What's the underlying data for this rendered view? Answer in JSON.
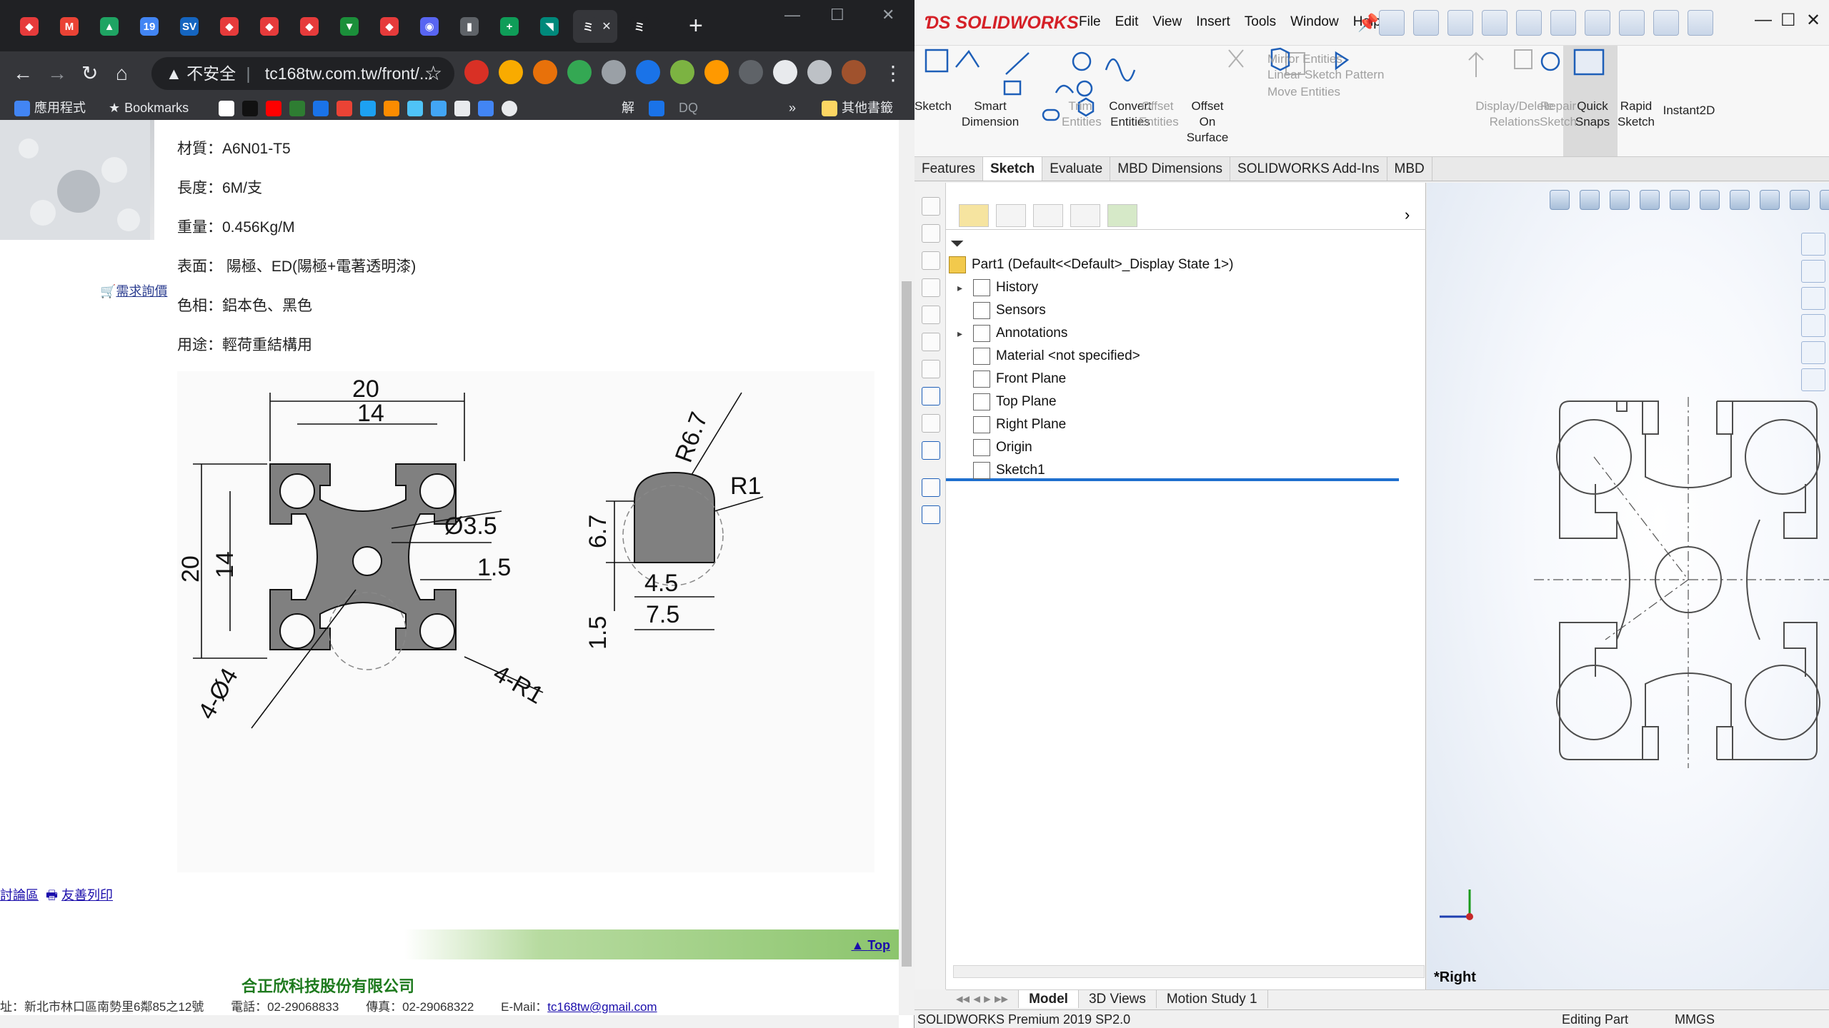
{
  "chrome": {
    "tabs": [
      {
        "icon": "red-app-icon",
        "color": "#e63b3b",
        "glyph": "◆"
      },
      {
        "icon": "gmail-icon",
        "color": "#ea4335",
        "glyph": "M"
      },
      {
        "icon": "drive-icon",
        "color": "#1fa463",
        "glyph": "▲"
      },
      {
        "icon": "calendar-icon",
        "color": "#4285f4",
        "glyph": "19"
      },
      {
        "icon": "sv-icon",
        "color": "#1565c0",
        "glyph": "SV"
      },
      {
        "icon": "red-app-icon",
        "color": "#e63b3b",
        "glyph": "◆"
      },
      {
        "icon": "red-app-icon",
        "color": "#e63b3b",
        "glyph": "◆"
      },
      {
        "icon": "red-app-icon",
        "color": "#e63b3b",
        "glyph": "◆"
      },
      {
        "icon": "green-hat-icon",
        "color": "#1b8f3a",
        "glyph": "▼"
      },
      {
        "icon": "red-app-icon",
        "color": "#e63b3b",
        "glyph": "◆"
      },
      {
        "icon": "discord-icon",
        "color": "#5865f2",
        "glyph": "◉"
      },
      {
        "icon": "book-icon",
        "color": "#5f6368",
        "glyph": "▮"
      },
      {
        "icon": "sheets-icon",
        "color": "#0f9d58",
        "glyph": "+"
      },
      {
        "icon": "teal-app-icon",
        "color": "#00897b",
        "glyph": "◥"
      },
      {
        "icon": "loading-icon",
        "color": "#35363a",
        "glyph": "ミ"
      },
      {
        "icon": "loading-icon",
        "color": "#202124",
        "glyph": "ミ"
      }
    ],
    "tab_close": "✕",
    "new_tab": "+",
    "omnibox": {
      "warning": "▲ 不安全",
      "url": "tc168tw.com.tw/front/..."
    },
    "bookmarks": {
      "apps": "應用程式",
      "bookmarks": "Bookmarks",
      "jie": "解",
      "dq": "DQ",
      "more": "»",
      "other": "其他書籤"
    },
    "colors": {
      "tabbar": "#202124",
      "toolbar": "#35363a",
      "link": "#1a0dab",
      "company": "#1e7a1e"
    }
  },
  "product": {
    "specs": [
      {
        "label": "材質：A6N01-T5"
      },
      {
        "label": "長度：6M/支"
      },
      {
        "label": "重量：0.456Kg/M"
      },
      {
        "label": "表面： 陽極、ED(陽極+電著透明漆)"
      },
      {
        "label": "色相：鋁本色、黑色"
      },
      {
        "label": "用途：輕荷重結構用"
      }
    ],
    "inquiry": "需求詢價",
    "drawing": {
      "dim_20_top": "20",
      "dim_14_top": "14",
      "dim_20_side": "20",
      "dim_14_side": "14",
      "hole": "Ø3.5",
      "dim_1_5": "1.5",
      "holes4": "4-Ø4",
      "radius4": "4-R1",
      "r6_7": "R6.7",
      "r1": "R1",
      "d6_7": "6.7",
      "d1_5": "1.5",
      "d4_5": "4.5",
      "d7_5": "7.5"
    },
    "links": {
      "forum": "討論區",
      "print": "友善列印"
    },
    "top": "Top",
    "company": "合正欣科技股份有限公司",
    "address": "址：新北市林口區南勢里6鄰85之12號",
    "phone": "電話：02-29068833",
    "fax": "傳真：02-29068322",
    "email_label": "E-Mail：",
    "email": "tc168tw@gmail.com"
  },
  "sw": {
    "logo": "SOLIDWORKS",
    "menu": [
      "File",
      "Edit",
      "View",
      "Insert",
      "Tools",
      "Window",
      "Help"
    ],
    "commands": [
      {
        "label": "Sketch",
        "enabled": true
      },
      {
        "label": "Smart\nDimension",
        "enabled": true
      },
      {
        "label": "Trim\nEntities",
        "enabled": false
      },
      {
        "label": "Convert\nEntities",
        "enabled": true
      },
      {
        "label": "Offset\nEntities",
        "enabled": false
      },
      {
        "label": "Offset\nOn\nSurface",
        "enabled": true
      },
      {
        "label": "Mirror Entities",
        "enabled": false
      },
      {
        "label": "Linear Sketch Pattern",
        "enabled": false
      },
      {
        "label": "Move Entities",
        "enabled": false
      },
      {
        "label": "Display/Delete\nRelations",
        "enabled": false
      },
      {
        "label": "Repair\nSketch",
        "enabled": false
      },
      {
        "label": "Quick\nSnaps",
        "enabled": true
      },
      {
        "label": "Rapid\nSketch",
        "enabled": true
      },
      {
        "label": "Instant2D",
        "enabled": true
      }
    ],
    "tabs": [
      "Features",
      "Sketch",
      "Evaluate",
      "MBD Dimensions",
      "SOLIDWORKS Add-Ins",
      "MBD"
    ],
    "active_tab": "Sketch",
    "tree": {
      "root": "Part1  (Default<<Default>_Display State 1>)",
      "items": [
        {
          "label": "History",
          "icon": "history-icon",
          "expandable": true
        },
        {
          "label": "Sensors",
          "icon": "sensors-icon",
          "expandable": false
        },
        {
          "label": "Annotations",
          "icon": "annotations-icon",
          "expandable": true
        },
        {
          "label": "Material <not specified>",
          "icon": "material-icon",
          "expandable": false
        },
        {
          "label": "Front Plane",
          "icon": "plane-icon",
          "expandable": false
        },
        {
          "label": "Top Plane",
          "icon": "plane-icon",
          "expandable": false
        },
        {
          "label": "Right Plane",
          "icon": "plane-icon",
          "expandable": false
        },
        {
          "label": "Origin",
          "icon": "origin-icon",
          "expandable": false
        },
        {
          "label": "Sketch1",
          "icon": "sketch-icon",
          "expandable": false
        }
      ]
    },
    "view_label": "*Right",
    "bottom_tabs": [
      "Model",
      "3D Views",
      "Motion Study 1"
    ],
    "active_bottom_tab": "Model",
    "status": {
      "version": "SOLIDWORKS Premium 2019 SP2.0",
      "mode": "Editing Part",
      "units": "MMGS"
    },
    "colors": {
      "logo": "#d52027",
      "selection": "#1e6fce"
    }
  }
}
